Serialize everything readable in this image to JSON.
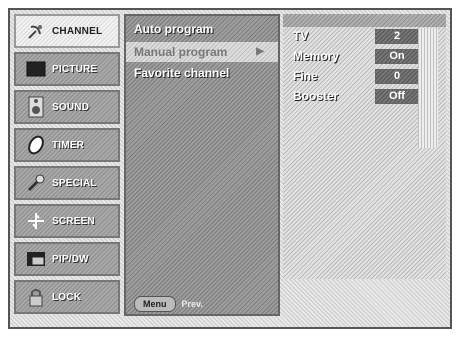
{
  "sidebar": {
    "items": [
      {
        "label": "CHANNEL",
        "icon": "satellite-dish-icon",
        "active": true
      },
      {
        "label": "PICTURE",
        "icon": "tv-screen-icon",
        "active": false
      },
      {
        "label": "SOUND",
        "icon": "speaker-icon",
        "active": false
      },
      {
        "label": "TIMER",
        "icon": "clock-icon",
        "active": false
      },
      {
        "label": "SPECIAL",
        "icon": "wrench-icon",
        "active": false
      },
      {
        "label": "SCREEN",
        "icon": "crosshair-icon",
        "active": false
      },
      {
        "label": "PIP/DW",
        "icon": "pip-window-icon",
        "active": false
      },
      {
        "label": "LOCK",
        "icon": "lock-icon",
        "active": false
      }
    ]
  },
  "menu": {
    "items": [
      {
        "label": "Auto program",
        "selected": false
      },
      {
        "label": "Manual program",
        "selected": true
      },
      {
        "label": "Favorite channel",
        "selected": false
      }
    ],
    "arrow": "▶"
  },
  "footer": {
    "menu_button": "Menu",
    "prev_label": "Prev."
  },
  "submenu": {
    "rows": [
      {
        "label": "TV",
        "value": "2"
      },
      {
        "label": "Memory",
        "value": "On"
      },
      {
        "label": "Fine",
        "value": "0"
      },
      {
        "label": "Booster",
        "value": "Off"
      }
    ]
  }
}
